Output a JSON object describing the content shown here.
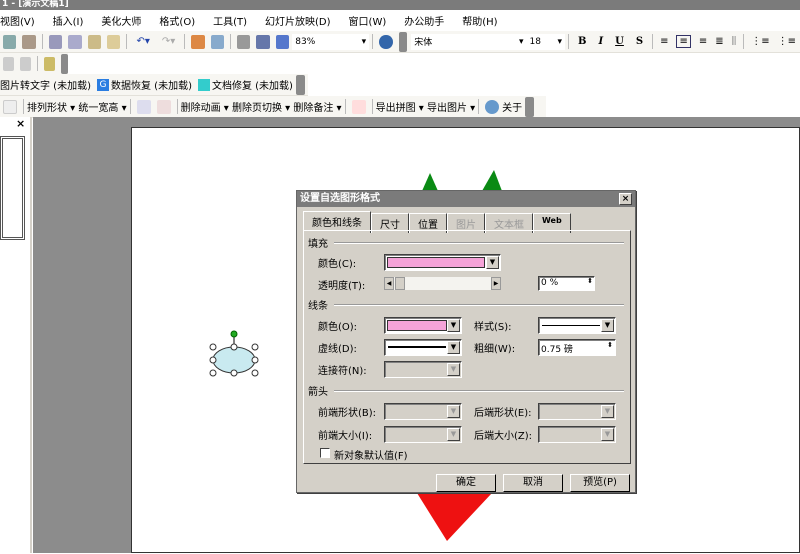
{
  "window": {
    "title": "1 - [演示文稿1]"
  },
  "menu": [
    "视图(V)",
    "插入(I)",
    "美化大师",
    "格式(O)",
    "工具(T)",
    "幻灯片放映(D)",
    "窗口(W)",
    "办公助手",
    "帮助(H)"
  ],
  "toolbar": {
    "zoom": "83%",
    "font": "宋体",
    "size": "18",
    "bold": "B",
    "italic": "I",
    "underline": "U",
    "shadow": "S"
  },
  "plugins": [
    "图片转文字 (未加载)",
    "数据恢复 (未加载)",
    "文档修复 (未加载)"
  ],
  "toolbar4": {
    "arrange": "排列形状",
    "unify": "统一宽高",
    "del_anim": "删除动画",
    "del_trans": "删除页切换",
    "del_notes": "删除备注",
    "export_collage": "导出拼图",
    "export_image": "导出图片",
    "about": "关于"
  },
  "panel": {
    "close": "×"
  },
  "dialog": {
    "title": "设置自选图形格式",
    "close": "×",
    "tabs": [
      "颜色和线条",
      "尺寸",
      "位置",
      "图片",
      "文本框",
      "Web"
    ],
    "fill": {
      "group": "填充",
      "color_label": "颜色(C):",
      "color": "#f5a3d8",
      "transparency_label": "透明度(T):",
      "transparency": "0 %"
    },
    "line": {
      "group": "线条",
      "color_label": "颜色(O):",
      "color": "#f5a3d8",
      "style_label": "样式(S):",
      "dash_label": "虚线(D):",
      "weight_label": "粗细(W):",
      "weight": "0.75 磅",
      "connector_label": "连接符(N):"
    },
    "arrows": {
      "group": "箭头",
      "begin_style": "前端形状(B):",
      "end_style": "后端形状(E):",
      "begin_size": "前端大小(I):",
      "end_size": "后端大小(Z):"
    },
    "default_label": "新对象默认值(F)",
    "default_checked": false,
    "ok": "确定",
    "cancel": "取消",
    "preview": "预览(P)"
  },
  "colors": {
    "shape_fill": "#c9eaf0",
    "green": "#0a8a14",
    "red": "#ee1111"
  }
}
